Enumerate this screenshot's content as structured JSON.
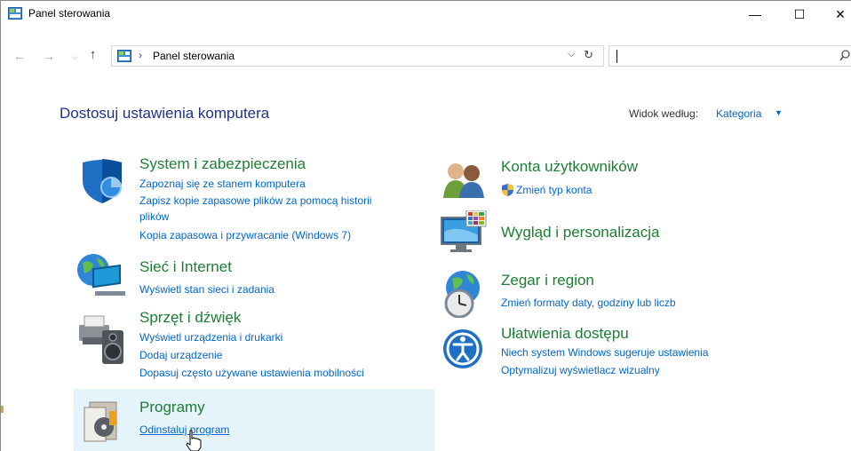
{
  "window": {
    "title": "Panel sterowania"
  },
  "controls": {
    "minimize": "—",
    "maximize": "☐",
    "close": "✕"
  },
  "address": {
    "path": "Panel sterowania",
    "search_placeholder": ""
  },
  "page": {
    "heading": "Dostosuj ustawienia komputera",
    "view_label": "Widok według:",
    "view_value": "Kategoria"
  },
  "categories": {
    "system": {
      "title": "System i zabezpieczenia",
      "links": [
        "Zapoznaj się ze stanem komputera",
        "Zapisz kopie zapasowe plików za pomocą historii",
        "plików",
        "Kopia zapasowa i przywracanie (Windows 7)"
      ]
    },
    "network": {
      "title": "Sieć i Internet",
      "links": [
        "Wyświetl stan sieci i zadania"
      ]
    },
    "hardware": {
      "title": "Sprzęt i dźwięk",
      "links": [
        "Wyświetl urządzenia i drukarki",
        "Dodaj urządzenie",
        "Dopasuj często używane ustawienia mobilności"
      ]
    },
    "programs": {
      "title": "Programy",
      "links": [
        "Odinstaluj program"
      ]
    },
    "users": {
      "title": "Konta użytkowników",
      "links": [
        "Zmień typ konta"
      ]
    },
    "appearance": {
      "title": "Wygląd i personalizacja"
    },
    "clock": {
      "title": "Zegar i region",
      "links": [
        "Zmień formaty daty, godziny lub liczb"
      ]
    },
    "access": {
      "title": "Ułatwienia dostępu",
      "links": [
        "Niech system Windows sugeruje ustawienia",
        "Optymalizuj wyświetlacz wizualny"
      ]
    }
  },
  "colors": {
    "accent_link": "#0066cc",
    "category_title": "#1e7d34",
    "heading": "#1e3287",
    "hover_bg": "#e5f3fb"
  }
}
